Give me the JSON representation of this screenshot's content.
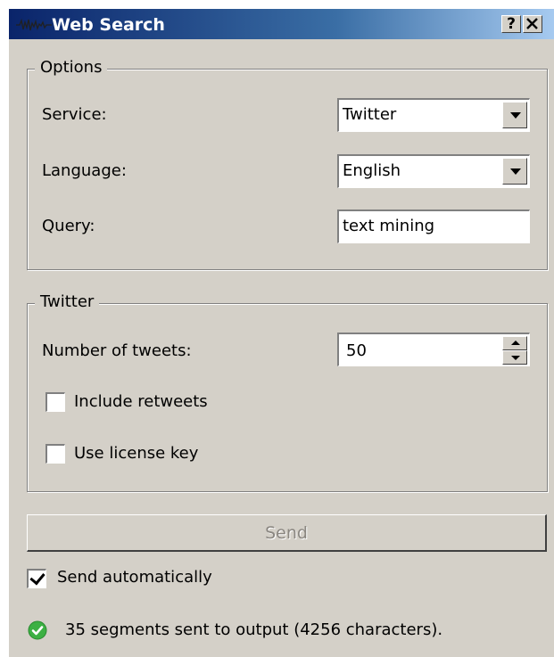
{
  "window": {
    "title": "Web Search",
    "help_button": "?",
    "close_button": "✕"
  },
  "options": {
    "legend": "Options",
    "service_label": "Service:",
    "service_value": "Twitter",
    "language_label": "Language:",
    "language_value": "English",
    "query_label": "Query:",
    "query_value": "text mining"
  },
  "twitter": {
    "legend": "Twitter",
    "tweets_label": "Number of tweets:",
    "tweets_value": "50",
    "include_retweets_label": "Include retweets",
    "include_retweets_checked": false,
    "license_key_label": "Use license key",
    "license_key_checked": false
  },
  "send": {
    "label": "Send",
    "enabled": false,
    "auto_label": "Send automatically",
    "auto_checked": true
  },
  "status": {
    "icon": "check-circle-icon",
    "text": "35 segments sent to output (4256 characters).",
    "color": "#3cb043"
  },
  "colors": {
    "title_gradient_start": "#0a246a",
    "title_gradient_end": "#a6caf0",
    "dialog_bg": "#d4d0c8"
  }
}
